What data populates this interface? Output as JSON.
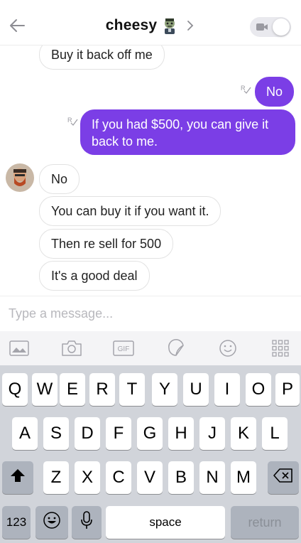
{
  "header": {
    "contact_name": "cheesy",
    "back_icon": "back-arrow-icon",
    "emoji_icon": "zombie-emoji-icon",
    "chevron_icon": "chevron-right-icon",
    "video_icon": "video-camera-icon"
  },
  "messages": [
    {
      "direction": "in",
      "text": "Buy it back off me"
    },
    {
      "direction": "out",
      "text": "No",
      "status_icon": "read-receipt-icon"
    },
    {
      "direction": "out",
      "text_line1": "If you had $500, you can give it",
      "text_line2": "back to me.",
      "status_icon": "read-receipt-icon"
    },
    {
      "direction": "in",
      "text": "No"
    },
    {
      "direction": "in",
      "text": "You can buy it if you want it."
    },
    {
      "direction": "in",
      "text": "Then re sell for 500"
    },
    {
      "direction": "in",
      "text": "It's a good deal"
    }
  ],
  "composer": {
    "placeholder": "Type a message...",
    "value": ""
  },
  "attachments": {
    "gif_label": "GIF",
    "icons": [
      "image-icon",
      "camera-icon",
      "gif-icon",
      "sticker-icon",
      "emoji-icon",
      "apps-grid-icon"
    ]
  },
  "keyboard": {
    "row1": [
      "Q",
      "W",
      "E",
      "R",
      "T",
      "Y",
      "U",
      "I",
      "O",
      "P"
    ],
    "row2": [
      "A",
      "S",
      "D",
      "F",
      "G",
      "H",
      "J",
      "K",
      "L"
    ],
    "row3": [
      "Z",
      "X",
      "C",
      "V",
      "B",
      "N",
      "M"
    ],
    "numbers_label": "123",
    "space_label": "space",
    "return_label": "return"
  },
  "colors": {
    "accent": "#7b3ee6",
    "keyboard_bg": "#d1d4da",
    "function_key": "#adb3bd"
  }
}
